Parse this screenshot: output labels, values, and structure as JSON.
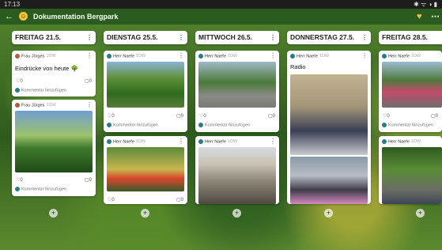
{
  "status_bar": {
    "time": "17:13",
    "icons_right": "✱ ᯤ ◑ ▮"
  },
  "app_bar": {
    "back_icon": "←",
    "emoji": "☺",
    "title": "Dokumentation Bergpark",
    "heart_icon": "♥",
    "more_icon": "⋯"
  },
  "columns": [
    {
      "title": "FREITAG 21.5."
    },
    {
      "title": "DIENSTAG 25.5."
    },
    {
      "title": "MITTWOCH 26.5."
    },
    {
      "title": "DONNERSTAG 27.5."
    },
    {
      "title": "FREITAG 28.5."
    }
  ],
  "cards": {
    "c1": {
      "author": "Frau Jörges",
      "time": "1DW",
      "text": "Eindrücke von heute 🌳",
      "likes": "0",
      "comments": "0",
      "comment_placeholder": "Kommentar hinzufügen"
    },
    "c2": {
      "author": "Frau Jörges",
      "time": "1DW",
      "likes": "0",
      "comments": "0",
      "comment_placeholder": "Kommentar hinzufügen"
    },
    "c3": {
      "author": "Herr Naefe",
      "time": "1DW",
      "likes": "0",
      "comments": "0",
      "comment_placeholder": "Kommentar hinzufügen"
    },
    "c4": {
      "author": "Herr Naefe",
      "time": "1DW",
      "likes": "0",
      "comments": "0"
    },
    "c5": {
      "author": "Herr Naefe",
      "time": "1DW",
      "likes": "0",
      "comments": "0",
      "comment_placeholder": "Kommentar hinzufügen"
    },
    "c6": {
      "author": "Herr Naefe",
      "time": "1DW"
    },
    "c7": {
      "author": "Herr Naefe",
      "time": "1DW",
      "text": "Radio"
    },
    "c8": {
      "author": "Herr Naefe",
      "time": "1DW",
      "likes": "0",
      "comments": "0",
      "comment_placeholder": "Kommentar hinzufügen"
    },
    "c9": {
      "author": "Herr Naefe",
      "time": "1DW"
    }
  },
  "add_button": "+",
  "colors": {
    "app_bar": "#2a5c1f",
    "accent": "#f4c23b",
    "avatar_teal": "#2b7a8a",
    "avatar_red": "#b55b3c"
  }
}
